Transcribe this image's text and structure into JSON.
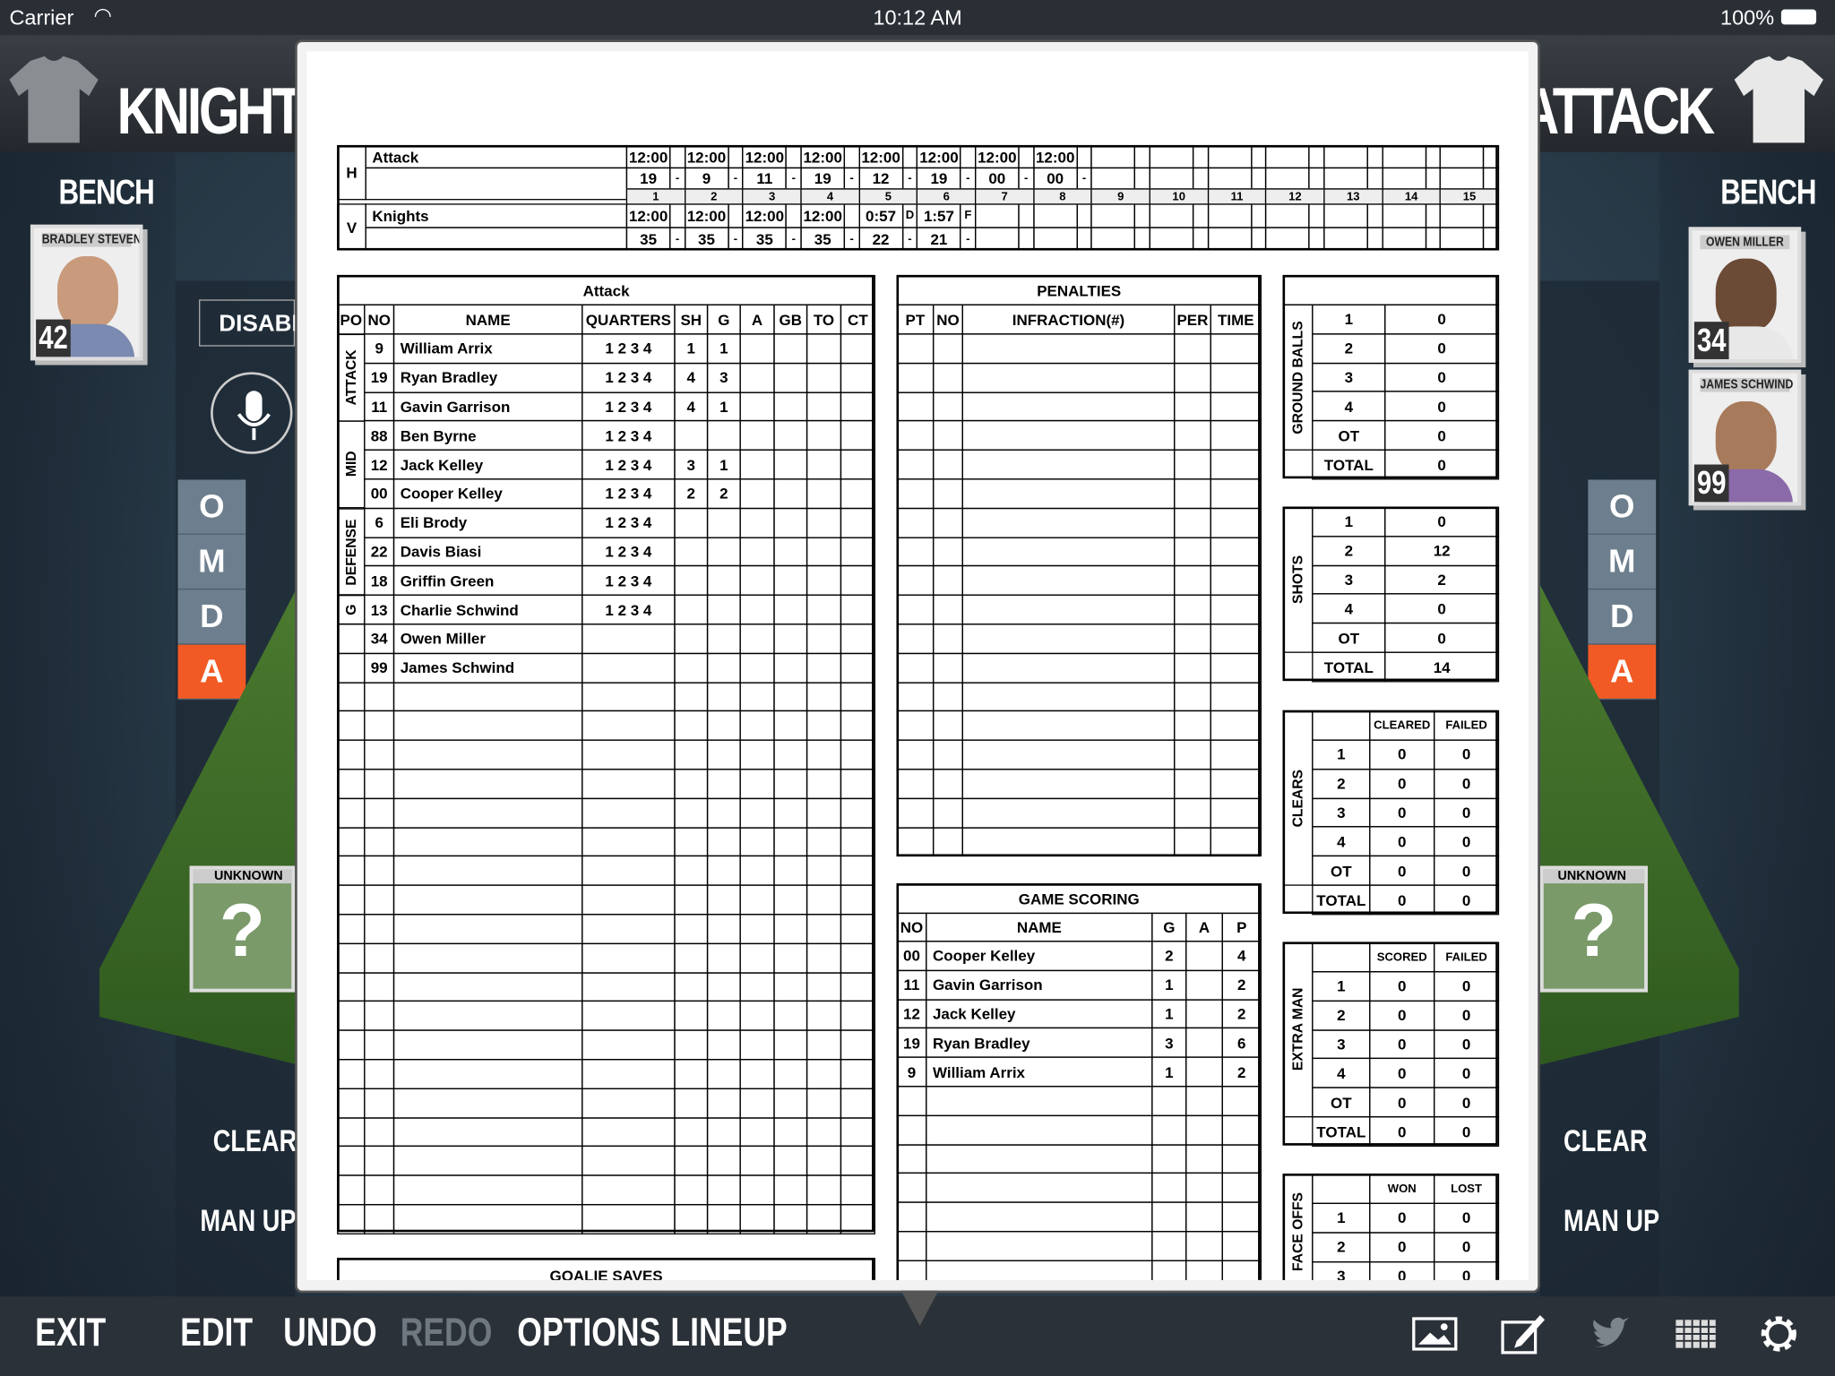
{
  "status": {
    "carrier": "Carrier",
    "time": "10:12 AM",
    "battery": "100%"
  },
  "header": {
    "home_team": "KNIGHTS",
    "away_team": "ATTACK"
  },
  "left": {
    "bench": "BENCH",
    "player": {
      "name": "BRADLEY STEVENS",
      "number": "42"
    },
    "disabled": "DISABLED",
    "positions": [
      "O",
      "M",
      "D",
      "A"
    ],
    "active_position": "A",
    "unknown": "UNKNOWN",
    "unknown_mark": "?",
    "clear": "CLEAR",
    "man_up": "MAN UP"
  },
  "right": {
    "bench": "BENCH",
    "players": [
      {
        "name": "OWEN MILLER",
        "number": "34"
      },
      {
        "name": "JAMES SCHWIND",
        "number": "99"
      }
    ],
    "positions": [
      "O",
      "M",
      "D",
      "A"
    ],
    "active_position": "A",
    "unknown": "UNKNOWN",
    "unknown_mark": "?",
    "clear": "CLEAR",
    "man_up": "MAN UP"
  },
  "toolbar": {
    "exit": "EXIT",
    "edit": "EDIT",
    "undo": "UNDO",
    "redo": "REDO",
    "options": "OPTIONS",
    "lineup": "LINEUP",
    "icons": [
      "photo-icon",
      "compose-icon",
      "twitter-icon",
      "grid-icon",
      "gear-icon"
    ]
  },
  "colors": {
    "accent": "#f15a24",
    "disabled_text": "#6f7780",
    "toolbar_bg": "#2b3138"
  },
  "sheet": {
    "score": {
      "home_label": "H",
      "home": "Attack",
      "visitor_label": "V",
      "visitor": "Knights",
      "periods": [
        "1",
        "2",
        "3",
        "4",
        "5",
        "6",
        "7",
        "8",
        "9",
        "10",
        "11",
        "12",
        "13",
        "14",
        "15"
      ],
      "home_times": [
        "12:00",
        "12:00",
        "12:00",
        "12:00",
        "12:00",
        "12:00",
        "12:00",
        "12:00"
      ],
      "home_marks": [
        "",
        "",
        "",
        "",
        "",
        "",
        "",
        ""
      ],
      "home_scores": [
        "19",
        "9",
        "11",
        "19",
        "12",
        "19",
        "00",
        "00"
      ],
      "home_score_marks": [
        "-",
        "-",
        "-",
        "-",
        "-",
        "-",
        "-",
        "-"
      ],
      "visitor_times": [
        "12:00",
        "12:00",
        "12:00",
        "12:00",
        "0:57",
        "1:57"
      ],
      "visitor_marks": [
        "",
        "",
        "",
        "",
        "D",
        "F"
      ],
      "visitor_scores": [
        "35",
        "35",
        "35",
        "35",
        "22",
        "21"
      ],
      "visitor_score_marks": [
        "-",
        "-",
        "-",
        "-",
        "-",
        "-"
      ]
    },
    "roster": {
      "title": "Attack",
      "headers": [
        "PO",
        "NO",
        "NAME",
        "QUARTERS",
        "SH",
        "G",
        "A",
        "GB",
        "TO",
        "CT"
      ],
      "groups": [
        {
          "label": "ATTACK",
          "rows": 3
        },
        {
          "label": "MID",
          "rows": 3
        },
        {
          "label": "DEFENSE",
          "rows": 3
        },
        {
          "label": "G",
          "rows": 1
        }
      ],
      "players": [
        {
          "no": "9",
          "name": "William Arrix",
          "quarters": "1 2 3 4",
          "sh": "1",
          "g": "1",
          "a": "",
          "gb": "",
          "to": "",
          "ct": ""
        },
        {
          "no": "19",
          "name": "Ryan Bradley",
          "quarters": "1 2 3 4",
          "sh": "4",
          "g": "3",
          "a": "",
          "gb": "",
          "to": "",
          "ct": ""
        },
        {
          "no": "11",
          "name": "Gavin Garrison",
          "quarters": "1 2 3 4",
          "sh": "4",
          "g": "1",
          "a": "",
          "gb": "",
          "to": "",
          "ct": ""
        },
        {
          "no": "88",
          "name": "Ben Byrne",
          "quarters": "1 2 3 4",
          "sh": "",
          "g": "",
          "a": "",
          "gb": "",
          "to": "",
          "ct": ""
        },
        {
          "no": "12",
          "name": "Jack Kelley",
          "quarters": "1 2 3 4",
          "sh": "3",
          "g": "1",
          "a": "",
          "gb": "",
          "to": "",
          "ct": ""
        },
        {
          "no": "00",
          "name": "Cooper Kelley",
          "quarters": "1 2 3 4",
          "sh": "2",
          "g": "2",
          "a": "",
          "gb": "",
          "to": "",
          "ct": ""
        },
        {
          "no": "6",
          "name": "Eli Brody",
          "quarters": "1 2 3 4",
          "sh": "",
          "g": "",
          "a": "",
          "gb": "",
          "to": "",
          "ct": ""
        },
        {
          "no": "22",
          "name": "Davis Biasi",
          "quarters": "1 2 3 4",
          "sh": "",
          "g": "",
          "a": "",
          "gb": "",
          "to": "",
          "ct": ""
        },
        {
          "no": "18",
          "name": "Griffin Green",
          "quarters": "1 2 3 4",
          "sh": "",
          "g": "",
          "a": "",
          "gb": "",
          "to": "",
          "ct": ""
        },
        {
          "no": "13",
          "name": "Charlie Schwind",
          "quarters": "1 2 3 4",
          "sh": "",
          "g": "",
          "a": "",
          "gb": "",
          "to": "",
          "ct": ""
        },
        {
          "no": "34",
          "name": "Owen Miller",
          "quarters": "",
          "sh": "",
          "g": "",
          "a": "",
          "gb": "",
          "to": "",
          "ct": ""
        },
        {
          "no": "99",
          "name": "James Schwind",
          "quarters": "",
          "sh": "",
          "g": "",
          "a": "",
          "gb": "",
          "to": "",
          "ct": ""
        }
      ]
    },
    "goalie_saves": {
      "title": "GOALIE SAVES"
    },
    "penalties": {
      "title": "PENALTIES",
      "headers": [
        "PT",
        "NO",
        "INFRACTION(#)",
        "PER",
        "TIME"
      ]
    },
    "game_scoring": {
      "title": "GAME SCORING",
      "headers": [
        "NO",
        "NAME",
        "G",
        "A",
        "P"
      ],
      "rows": [
        {
          "no": "00",
          "name": "Cooper Kelley",
          "g": "2",
          "a": "",
          "p": "4"
        },
        {
          "no": "11",
          "name": "Gavin Garrison",
          "g": "1",
          "a": "",
          "p": "2"
        },
        {
          "no": "12",
          "name": "Jack Kelley",
          "g": "1",
          "a": "",
          "p": "2"
        },
        {
          "no": "19",
          "name": "Ryan Bradley",
          "g": "3",
          "a": "",
          "p": "6"
        },
        {
          "no": "9",
          "name": "William Arrix",
          "g": "1",
          "a": "",
          "p": "2"
        }
      ]
    },
    "ground_balls": {
      "label": "GROUND BALLS",
      "rows": [
        [
          "1",
          "0"
        ],
        [
          "2",
          "0"
        ],
        [
          "3",
          "0"
        ],
        [
          "4",
          "0"
        ],
        [
          "OT",
          "0"
        ]
      ],
      "total": [
        "TOTAL",
        "0"
      ]
    },
    "shots": {
      "label": "SHOTS",
      "rows": [
        [
          "1",
          "0"
        ],
        [
          "2",
          "12"
        ],
        [
          "3",
          "2"
        ],
        [
          "4",
          "0"
        ],
        [
          "OT",
          "0"
        ]
      ],
      "total": [
        "TOTAL",
        "14"
      ]
    },
    "clears": {
      "label": "CLEARS",
      "headers": [
        "CLEARED",
        "FAILED"
      ],
      "rows": [
        [
          "1",
          "0",
          "0"
        ],
        [
          "2",
          "0",
          "0"
        ],
        [
          "3",
          "0",
          "0"
        ],
        [
          "4",
          "0",
          "0"
        ],
        [
          "OT",
          "0",
          "0"
        ]
      ],
      "total": [
        "TOTAL",
        "0",
        "0"
      ]
    },
    "extra_man": {
      "label": "EXTRA MAN",
      "headers": [
        "SCORED",
        "FAILED"
      ],
      "rows": [
        [
          "1",
          "0",
          "0"
        ],
        [
          "2",
          "0",
          "0"
        ],
        [
          "3",
          "0",
          "0"
        ],
        [
          "4",
          "0",
          "0"
        ],
        [
          "OT",
          "0",
          "0"
        ]
      ],
      "total": [
        "TOTAL",
        "0",
        "0"
      ]
    },
    "face_offs": {
      "label": "FACE OFFS",
      "headers": [
        "WON",
        "LOST"
      ],
      "rows": [
        [
          "1",
          "0",
          "0"
        ],
        [
          "2",
          "0",
          "0"
        ],
        [
          "3",
          "0",
          "0"
        ]
      ]
    }
  }
}
